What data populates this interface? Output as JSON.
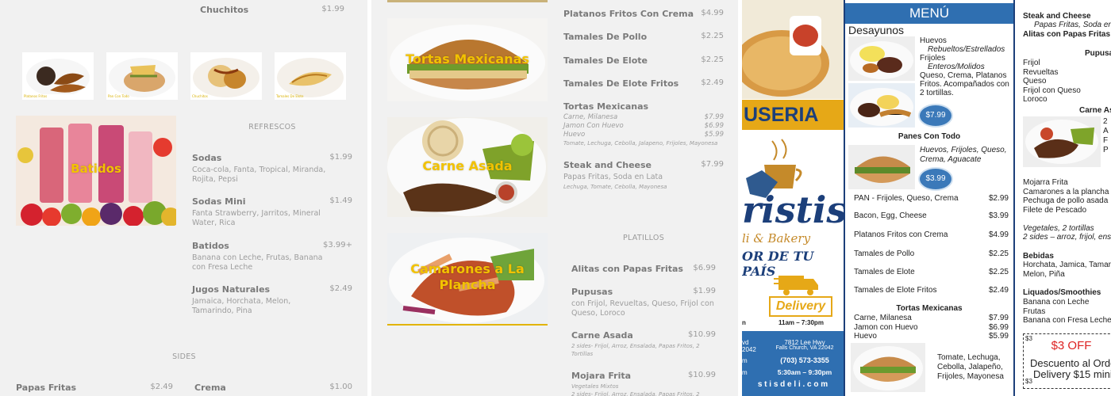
{
  "left": {
    "top_item": {
      "name": "Chuchitos",
      "price": "$1.99"
    },
    "thumbs": [
      {
        "caption": "Platanos Fritos"
      },
      {
        "caption": "Pan Con Todo"
      },
      {
        "caption": "Chuchitos"
      },
      {
        "caption": "Tamales De Elote"
      }
    ],
    "batidos_caption": "Batidos",
    "refrescos_title": "REFRESCOS",
    "refrescos": [
      {
        "name": "Sodas",
        "price": "$1.99",
        "desc": "Coca-cola, Fanta, Tropical, Miranda, Rojita, Pepsi"
      },
      {
        "name": "Sodas Mini",
        "price": "$1.49",
        "desc": "Fanta Strawberry, Jarritos, Mineral Water, Rica"
      },
      {
        "name": "Batidos",
        "price": "$3.99+",
        "desc": "Banana con Leche, Frutas, Banana con Fresa Leche"
      },
      {
        "name": "Jugos Naturales",
        "price": "$2.49",
        "desc": "Jamaica, Horchata, Melon, Tamarindo, Pina"
      }
    ],
    "sides_title": "SIDES",
    "sides": [
      {
        "name": "Papas Fritas",
        "price": "$2.49"
      },
      {
        "name": "Crema",
        "price": "$1.00"
      }
    ]
  },
  "middle": {
    "photos": [
      {
        "caption": "Tortas Mexicanas"
      },
      {
        "caption": "Carne Asada"
      },
      {
        "caption": "Camarones a La Plancha"
      }
    ],
    "items": [
      {
        "name": "Platanos Fritos Con Crema",
        "price": "$4.99"
      },
      {
        "name": "Tamales De Pollo",
        "price": "$2.25"
      },
      {
        "name": "Tamales De Elote",
        "price": "$2.25"
      },
      {
        "name": "Tamales De Elote Fritos",
        "price": "$2.49"
      }
    ],
    "tortas": {
      "name": "Tortas Mexicanas",
      "price": "$7.99",
      "lines": [
        {
          "name": "Carne, Milanesa",
          "price": "$7.99"
        },
        {
          "name": "Jamon Con Huevo",
          "price": "$6.99"
        },
        {
          "name": "Huevo",
          "price": "$5.99"
        }
      ],
      "note": "Tomate, Lechuga, Cebolla, Jalapeno, Frijoles, Mayonesa"
    },
    "steak": {
      "name": "Steak and Cheese",
      "price": "$7.99",
      "desc": "Papas Fritas, Soda en Lata",
      "note": "Lechuga, Tomate, Cebolla, Mayonesa"
    },
    "platillos_title": "PLATILLOS",
    "platillos": [
      {
        "name": "Alitas con Papas Fritas",
        "price": "$6.99",
        "desc": "",
        "note": ""
      },
      {
        "name": "Pupusas",
        "price": "$1.99",
        "desc": "con Frijol, Revueltas, Queso, Frijol con Queso, Loroco",
        "note": ""
      },
      {
        "name": "Carne Asada",
        "price": "$10.99",
        "desc": "",
        "note": "2 sides- Frijol, Arroz, Ensalada, Papas Fritos, 2 Tortillas"
      },
      {
        "name": "Mojara Frita",
        "price": "$10.99",
        "desc": "",
        "note": "Vegetales Mixtos\n2 sides- Frijol, Arroz, Ensalada, Papas Fritos, 2"
      }
    ]
  },
  "flyer": {
    "brand_fragment": "USERIA",
    "logo_text": "ristis",
    "tagline_a": "li & Bakery",
    "tagline_b": "OR DE TU PAÍS",
    "delivery": "Delivery",
    "hours_left": "n",
    "hours": "11am – 7:30pm",
    "addr_left_a": "vd",
    "addr_left_b": "2042",
    "addr_left_c": "m",
    "addr_left_d": "m",
    "address1": "7812 Lee Hwy",
    "address2": "Falls Church, VA 22042",
    "phone": "(703) 573-3355",
    "hours2": "5:30am – 9:30pm",
    "website": "s t i s d e l i . c o m",
    "menu_title": "MENÚ",
    "desayunos": "Desayunos",
    "huevos_title": "Huevos",
    "huevos_it1": "Rebueltos/Estrellados",
    "huevos_line2": "Frijoles",
    "huevos_it2": "Enteros/Molidos",
    "huevos_rest": "Queso, Crema, Platanos Fritos. Acompañados con 2 tortillas.",
    "price_desayuno": "$7.99",
    "panes_title": "Panes Con Todo",
    "panes_desc": "Huevos, Frijoles, Queso, Crema, Aguacate",
    "price_panes": "$3.99",
    "items": [
      {
        "name": "PAN - Frijoles, Queso, Crema",
        "price": "$2.99"
      },
      {
        "name": "Bacon, Egg, Cheese",
        "price": "$3.99"
      },
      {
        "name": "Platanos Fritos con Crema",
        "price": "$4.99"
      },
      {
        "name": "Tamales de Pollo",
        "price": "$2.25"
      },
      {
        "name": "Tamales de Elote",
        "price": "$2.25"
      },
      {
        "name": "Tamales de Elote Fritos",
        "price": "$2.49"
      }
    ],
    "tortas_title": "Tortas Mexicanas",
    "tortas": [
      {
        "name": "Carne, Milanesa",
        "price": "$7.99"
      },
      {
        "name": "Jamon con Huevo",
        "price": "$6.99"
      },
      {
        "name": "Huevo",
        "price": "$5.99"
      }
    ],
    "tortas_note": "Tomate, Lechuga, Cebolla, Jalapeño, Frijoles, Mayonesa",
    "r_steak": "Steak and Cheese",
    "r_steak_desc": "Papas Fritas, Soda en",
    "r_alitas": "Alitas con Papas Fritas",
    "r_pupusas": "Pupusa",
    "r_pupusa_list": [
      "Frijol",
      "Revueltas",
      "Queso",
      "Frijol con Queso",
      "Loroco"
    ],
    "r_carne": "Carne As",
    "r_carne_side": [
      "2",
      "A",
      "F",
      "P"
    ],
    "r_list": [
      "Mojarra Frita",
      "Camarones a la plancha",
      "Pechuga de pollo asada",
      "Filete de Pescado"
    ],
    "r_veg1": "Vegetales, 2 tortillas",
    "r_veg2": "2 sides – arroz, frijol, ens",
    "r_bebidas": "Bebidas",
    "r_bebidas_desc": "Horchata, Jamica, Tamari Melon, Piña",
    "r_liq": "Liquados/Smoothies",
    "r_liq_list": [
      "Banana con Leche",
      "Frutas",
      "Banana con Fresa Leche"
    ],
    "coupon_corner": "$3",
    "coupon_title": "$3 OFF",
    "coupon_l1": "Descuento al Orde",
    "coupon_l2": "Delivery $15 mini",
    "coupon_corner2": "$3"
  },
  "colors": {
    "menu_blue": "#2f6fb1",
    "gold": "#f2c200",
    "brand_gold": "#e6a817"
  }
}
